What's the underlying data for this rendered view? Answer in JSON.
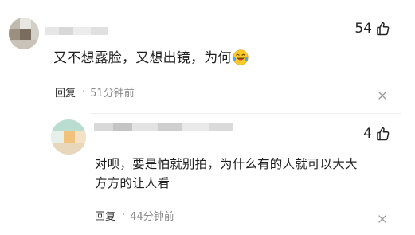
{
  "comment": {
    "likes": "54",
    "text": "又不想露脸，又想出镜，为何",
    "reply_label": "回复",
    "separator": "·",
    "time": "51分钟前"
  },
  "reply": {
    "likes": "4",
    "text_line1": "对呗，要是怕就别拍，为什么有的人就可以大大",
    "text_line2": "方方的让人看",
    "reply_label": "回复",
    "separator": "·",
    "time": "44分钟前"
  }
}
